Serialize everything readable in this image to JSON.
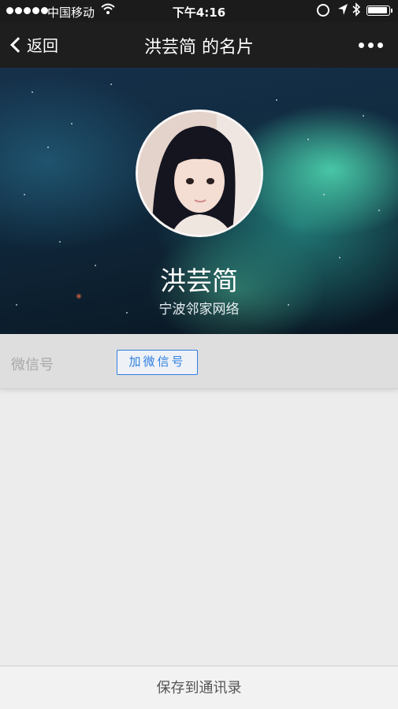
{
  "status_bar": {
    "carrier": "中国移动",
    "time": "下午4:16"
  },
  "nav": {
    "back_label": "返回",
    "title": "洪芸简 的名片"
  },
  "profile": {
    "name": "洪芸简",
    "company": "宁波邻家网络"
  },
  "wechat": {
    "label": "微信号",
    "add_button": "加微信号"
  },
  "bottom": {
    "save_label": "保存到通讯录"
  },
  "colors": {
    "accent": "#2f7fe0",
    "nav_bg": "#1e1e1e"
  }
}
